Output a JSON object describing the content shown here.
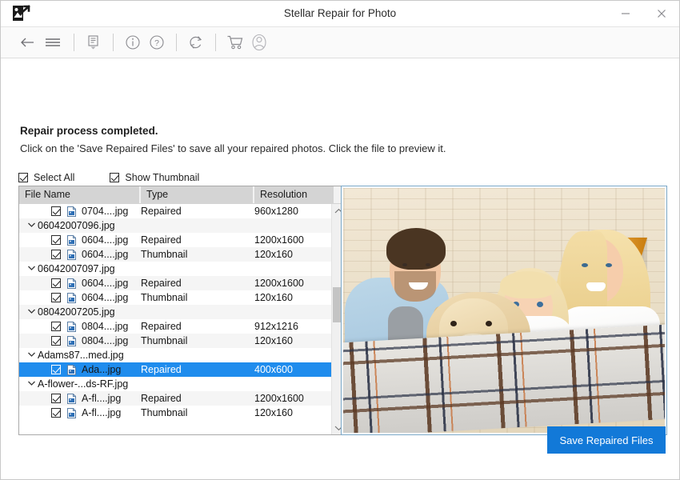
{
  "window": {
    "title": "Stellar Repair for Photo",
    "app_icon": "photo-arrow-icon",
    "minimize_label": "—",
    "close_label": "✕"
  },
  "toolbar": {
    "items": [
      {
        "name": "back-icon",
        "glyph": "←"
      },
      {
        "name": "menu-icon",
        "glyph": "☰"
      },
      {
        "name": "log-report-icon",
        "glyph": "὜E"
      },
      {
        "name": "info-icon",
        "glyph": "i"
      },
      {
        "name": "help-icon",
        "glyph": "?"
      },
      {
        "name": "refresh-icon",
        "glyph": "↻"
      },
      {
        "name": "cart-icon",
        "glyph": "Ὥ2"
      },
      {
        "name": "account-icon",
        "glyph": "☺"
      }
    ]
  },
  "message": {
    "title": "Repair process completed.",
    "subtitle": "Click on the 'Save Repaired Files' to save all your repaired photos. Click the file to preview it."
  },
  "options": {
    "select_all": {
      "label": "Select All",
      "checked": true
    },
    "show_thumbnail": {
      "label": "Show Thumbnail",
      "checked": true
    }
  },
  "file_list": {
    "columns": [
      "File Name",
      "Type",
      "Resolution"
    ],
    "rows": [
      {
        "kind": "file",
        "checked": true,
        "name": "0704....jpg",
        "type": "Repaired",
        "resolution": "960x1280",
        "selected": false
      },
      {
        "kind": "group",
        "name": "06042007096.jpg"
      },
      {
        "kind": "file",
        "checked": true,
        "name": "0604....jpg",
        "type": "Repaired",
        "resolution": "1200x1600",
        "selected": false
      },
      {
        "kind": "file",
        "checked": true,
        "name": "0604....jpg",
        "type": "Thumbnail",
        "resolution": "120x160",
        "selected": false
      },
      {
        "kind": "group",
        "name": "06042007097.jpg"
      },
      {
        "kind": "file",
        "checked": true,
        "name": "0604....jpg",
        "type": "Repaired",
        "resolution": "1200x1600",
        "selected": false
      },
      {
        "kind": "file",
        "checked": true,
        "name": "0604....jpg",
        "type": "Thumbnail",
        "resolution": "120x160",
        "selected": false
      },
      {
        "kind": "group",
        "name": "08042007205.jpg"
      },
      {
        "kind": "file",
        "checked": true,
        "name": "0804....jpg",
        "type": "Repaired",
        "resolution": "912x1216",
        "selected": false
      },
      {
        "kind": "file",
        "checked": true,
        "name": "0804....jpg",
        "type": "Thumbnail",
        "resolution": "120x160",
        "selected": false
      },
      {
        "kind": "group",
        "name": "Adams87...med.jpg"
      },
      {
        "kind": "file",
        "checked": true,
        "name": "Ada...jpg",
        "type": "Repaired",
        "resolution": "400x600",
        "selected": true
      },
      {
        "kind": "group",
        "name": "A-flower-...ds-RF.jpg"
      },
      {
        "kind": "file",
        "checked": true,
        "name": "A-fl....jpg",
        "type": "Repaired",
        "resolution": "1200x1600",
        "selected": false
      },
      {
        "kind": "file",
        "checked": true,
        "name": "A-fl....jpg",
        "type": "Thumbnail",
        "resolution": "120x160",
        "selected": false
      }
    ],
    "scrollbar": {
      "up_icon": "chevron-up-icon",
      "down_icon": "chevron-down-icon"
    }
  },
  "preview": {
    "alt": "family-with-golden-retriever-photo"
  },
  "footer": {
    "save_label": "Save Repaired Files"
  },
  "colors": {
    "accent": "#1279d8",
    "selection": "#1f8ced",
    "header_bg": "#d4d4d4",
    "lamp": "#e08c10"
  }
}
